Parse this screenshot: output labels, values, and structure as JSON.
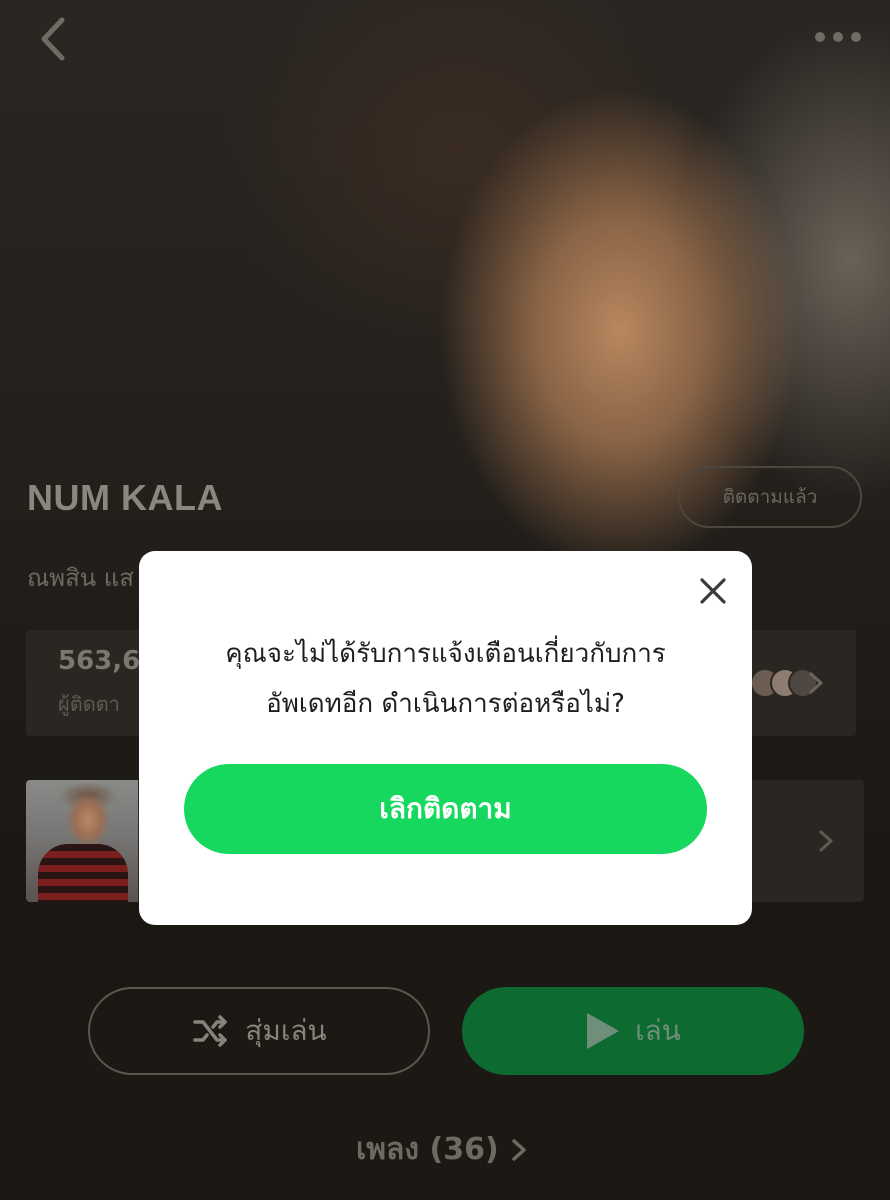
{
  "artist": {
    "name": "NUM KALA",
    "follow_button": "ติดตามแล้ว",
    "description": "ณพสิน แส"
  },
  "stats": {
    "followers_count": "563,6",
    "followers_label": "ผู้ติดตา"
  },
  "actions": {
    "shuffle_label": "สุ่มเล่น",
    "play_label": "เล่น"
  },
  "songs": {
    "label": "เพลง (36)"
  },
  "dialog": {
    "message_line1": "คุณจะไม่ได้รับการแจ้งเตือนเกี่ยวกับการ",
    "message_line2": "อัพเดทอีก ดำเนินการต่อหรือไม่?",
    "confirm_label": "เลิกติดตาม"
  },
  "icons": {
    "back": "back-icon",
    "more": "more-icon",
    "close": "close-icon",
    "shuffle": "shuffle-icon",
    "play": "play-icon",
    "chevron": "chevron-right-icon"
  },
  "colors": {
    "accent_green": "#17d85f",
    "play_green_dimmed": "#0d6a31"
  }
}
